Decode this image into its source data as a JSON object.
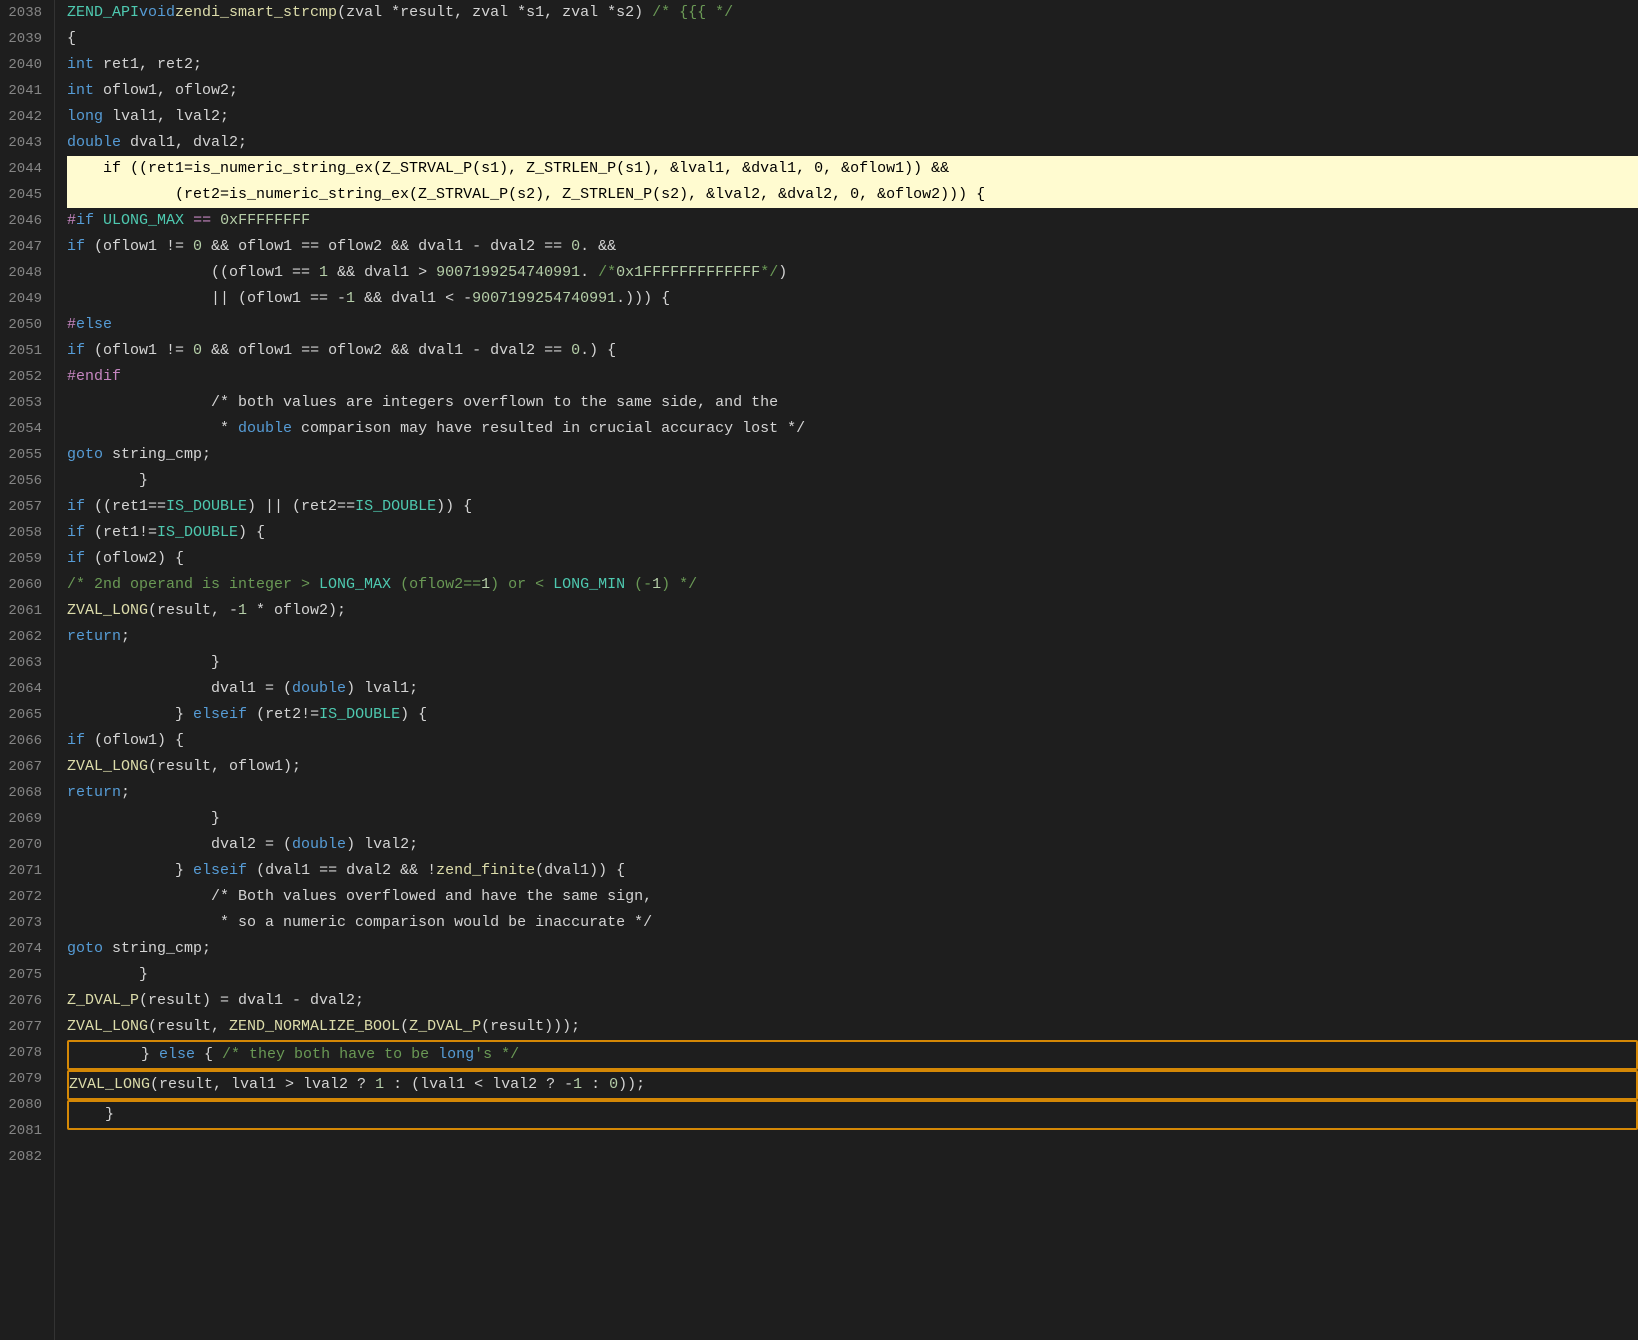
{
  "lines": [
    {
      "num": 2038,
      "content": [],
      "highlighted": false
    },
    {
      "num": 2039,
      "content": "ZEND_API void zendi_smart_strcmp(zval *result, zval *s1, zval *s2) /* {{{ */",
      "highlighted": false
    },
    {
      "num": 2040,
      "content": "{",
      "highlighted": false
    },
    {
      "num": 2041,
      "content": "    int ret1, ret2;",
      "highlighted": false
    },
    {
      "num": 2042,
      "content": "    int oflow1, oflow2;",
      "highlighted": false
    },
    {
      "num": 2043,
      "content": "    long lval1, lval2;",
      "highlighted": false
    },
    {
      "num": 2044,
      "content": "    double dval1, dval2;",
      "highlighted": false
    },
    {
      "num": 2045,
      "content": "",
      "highlighted": false
    },
    {
      "num": 2046,
      "content": "    if ((ret1=is_numeric_string_ex(Z_STRVAL_P(s1), Z_STRLEN_P(s1), &lval1, &dval1, 0, &oflow1)) &&",
      "highlighted": true
    },
    {
      "num": 2047,
      "content": "            (ret2=is_numeric_string_ex(Z_STRVAL_P(s2), Z_STRLEN_P(s2), &lval2, &dval2, 0, &oflow2))) {",
      "highlighted": true
    },
    {
      "num": 2048,
      "content": "#if ULONG_MAX == 0xFFFFFFFF",
      "highlighted": false
    },
    {
      "num": 2049,
      "content": "        if (oflow1 != 0 && oflow1 == oflow2 && dval1 - dval2 == 0. &&",
      "highlighted": false
    },
    {
      "num": 2050,
      "content": "                ((oflow1 == 1 && dval1 > 9007199254740991. /*0x1FFFFFFFFFFFFF*/)",
      "highlighted": false
    },
    {
      "num": 2051,
      "content": "                || (oflow1 == -1 && dval1 < -9007199254740991.))) {",
      "highlighted": false
    },
    {
      "num": 2052,
      "content": "#else",
      "highlighted": false
    },
    {
      "num": 2053,
      "content": "        if (oflow1 != 0 && oflow1 == oflow2 && dval1 - dval2 == 0.) {",
      "highlighted": false
    },
    {
      "num": 2054,
      "content": "#endif",
      "highlighted": false
    },
    {
      "num": 2055,
      "content": "                /* both values are integers overflown to the same side, and the",
      "highlighted": false
    },
    {
      "num": 2056,
      "content": "                 * double comparison may have resulted in crucial accuracy lost */",
      "highlighted": false
    },
    {
      "num": 2057,
      "content": "                goto string_cmp;",
      "highlighted": false
    },
    {
      "num": 2058,
      "content": "        }",
      "highlighted": false
    },
    {
      "num": 2059,
      "content": "        if ((ret1==IS_DOUBLE) || (ret2==IS_DOUBLE)) {",
      "highlighted": false
    },
    {
      "num": 2060,
      "content": "            if (ret1!=IS_DOUBLE) {",
      "highlighted": false
    },
    {
      "num": 2061,
      "content": "                if (oflow2) {",
      "highlighted": false
    },
    {
      "num": 2062,
      "content": "                    /* 2nd operand is integer > LONG_MAX (oflow2==1) or < LONG_MIN (-1) */",
      "highlighted": false
    },
    {
      "num": 2063,
      "content": "                    ZVAL_LONG(result, -1 * oflow2);",
      "highlighted": false
    },
    {
      "num": 2064,
      "content": "                    return;",
      "highlighted": false
    },
    {
      "num": 2065,
      "content": "                }",
      "highlighted": false
    },
    {
      "num": 2066,
      "content": "                dval1 = (double) lval1;",
      "highlighted": false
    },
    {
      "num": 2067,
      "content": "            } else if (ret2!=IS_DOUBLE) {",
      "highlighted": false
    },
    {
      "num": 2068,
      "content": "                if (oflow1) {",
      "highlighted": false
    },
    {
      "num": 2069,
      "content": "                    ZVAL_LONG(result, oflow1);",
      "highlighted": false
    },
    {
      "num": 2070,
      "content": "                    return;",
      "highlighted": false
    },
    {
      "num": 2071,
      "content": "                }",
      "highlighted": false
    },
    {
      "num": 2072,
      "content": "                dval2 = (double) lval2;",
      "highlighted": false
    },
    {
      "num": 2073,
      "content": "            } else if (dval1 == dval2 && !zend_finite(dval1)) {",
      "highlighted": false
    },
    {
      "num": 2074,
      "content": "                /* Both values overflowed and have the same sign,",
      "highlighted": false
    },
    {
      "num": 2075,
      "content": "                 * so a numeric comparison would be inaccurate */",
      "highlighted": false
    },
    {
      "num": 2076,
      "content": "                goto string_cmp;",
      "highlighted": false
    },
    {
      "num": 2077,
      "content": "        }",
      "highlighted": false
    },
    {
      "num": 2078,
      "content": "            Z_DVAL_P(result) = dval1 - dval2;",
      "highlighted": false
    },
    {
      "num": 2079,
      "content": "            ZVAL_LONG(result, ZEND_NORMALIZE_BOOL(Z_DVAL_P(result)));",
      "highlighted": false
    },
    {
      "num": 2080,
      "content": "        } else { /* they both have to be long's */",
      "highlighted": false,
      "boxed": true
    },
    {
      "num": 2081,
      "content": "            ZVAL_LONG(result, lval1 > lval2 ? 1 : (lval1 < lval2 ? -1 : 0));",
      "highlighted": false,
      "boxed": true
    },
    {
      "num": 2082,
      "content": "    }",
      "highlighted": false,
      "boxed": true
    }
  ]
}
